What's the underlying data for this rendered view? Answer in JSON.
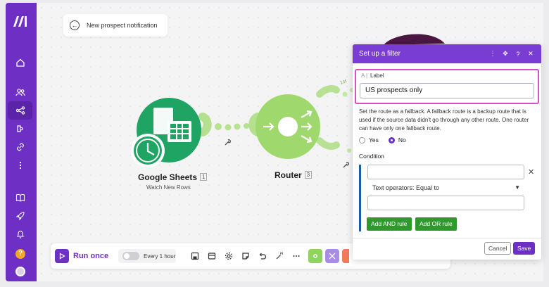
{
  "scenario": {
    "back_title": "New prospect notification"
  },
  "nodes": {
    "sheets": {
      "label": "Google Sheets",
      "number": "1",
      "subtitle": "Watch New Rows"
    },
    "router": {
      "label": "Router",
      "number": "3"
    },
    "route_badge": "1st"
  },
  "toolbar": {
    "run_label": "Run once",
    "schedule_label": "Every 1 hour"
  },
  "filter_panel": {
    "title": "Set up a filter",
    "label_caption": "Label",
    "label_value": "US prospects only",
    "fallback_text": "Set the route as a fallback. A fallback route is a backup route that is used if the source data didn't go through any other route. One router can have only one fallback route.",
    "fallback_options": [
      "Yes",
      "No"
    ],
    "fallback_selected": "No",
    "condition_label": "Condition",
    "operator": "Text operators: Equal to",
    "add_and_label": "Add AND rule",
    "add_or_label": "Add OR rule",
    "cancel_label": "Cancel",
    "save_label": "Save"
  },
  "colors": {
    "brand": "#6d2fc4",
    "panel_header": "#7a3dd4",
    "sheets_green": "#1fa463",
    "router_green": "#9fd96d",
    "rule_button": "#2e9a2e",
    "label_highlight": "#d94fc6"
  },
  "icons": [
    "make-logo-icon",
    "home-icon",
    "team-icon",
    "scenarios-icon",
    "templates-icon",
    "connections-icon",
    "more-icon",
    "docs-icon",
    "rocket-icon",
    "bell-icon",
    "help-icon",
    "avatar-icon"
  ]
}
